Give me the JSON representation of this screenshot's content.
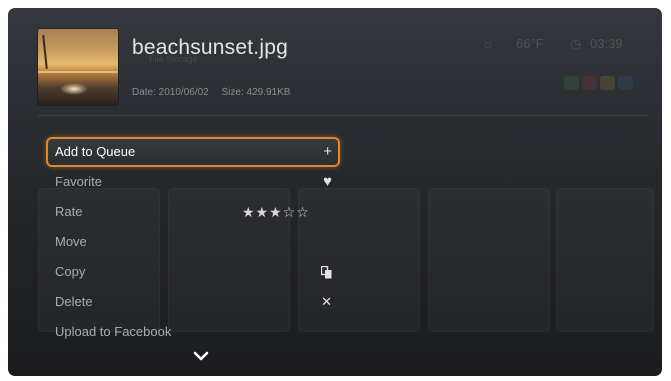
{
  "file": {
    "name": "beachsunset.jpg",
    "date_label": "Date: 2010/06/02",
    "size_label": "Size: 429.91KB",
    "thumbnail_icon": "beach-sunset-thumbnail"
  },
  "background": {
    "faded_text": "File Storage",
    "weather_icon": "sun-icon",
    "temperature": "66°F",
    "clock_icon": "clock-icon",
    "time": "03:39"
  },
  "menu": {
    "items": [
      {
        "label": "Add to Queue",
        "icon": "plus-icon",
        "glyph": "+",
        "selected": true
      },
      {
        "label": "Favorite",
        "icon": "heart-icon",
        "glyph": "♥"
      },
      {
        "label": "Rate",
        "rating": 3,
        "rating_max": 5,
        "stars": "★★★☆☆"
      },
      {
        "label": "Move"
      },
      {
        "label": "Copy",
        "icon": "copy-icon",
        "glyph": "⧉"
      },
      {
        "label": "Delete",
        "icon": "delete-x-icon",
        "glyph": "✕"
      },
      {
        "label": "Upload to Facebook"
      }
    ],
    "more_icon": "chevron-down-icon"
  },
  "colors": {
    "accent": "#e3892a",
    "background": "#2a2d31",
    "text": "#e4e4e4",
    "dim_text": "#8b8d91"
  }
}
